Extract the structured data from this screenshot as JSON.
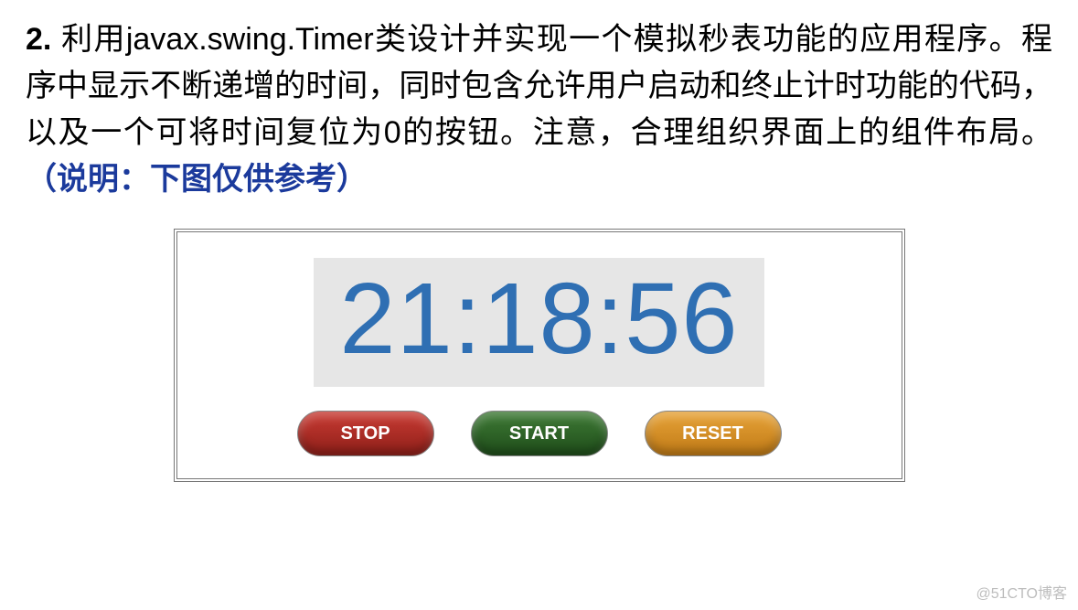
{
  "question": {
    "number": "2.",
    "text_part1": " 利用javax.swing.Timer类设计并实现一个模拟秒表功能的应用程序。程序中显示不断递增的时间，同时包含允许用户启动和终止计时功能的代码，以及一个可将时间复位为0的按钮。注意，合理组织界面上的组件布局。",
    "note": "（说明：下图仅供参考）"
  },
  "stopwatch": {
    "time_display": "21:18:56",
    "buttons": {
      "stop": "STOP",
      "start": "START",
      "reset": "RESET"
    },
    "colors": {
      "display_text": "#2f6fb3",
      "display_bg": "#e6e6e6",
      "stop": "#a52821",
      "start": "#2a6123",
      "reset": "#cc8820"
    }
  },
  "watermark": "@51CTO博客"
}
